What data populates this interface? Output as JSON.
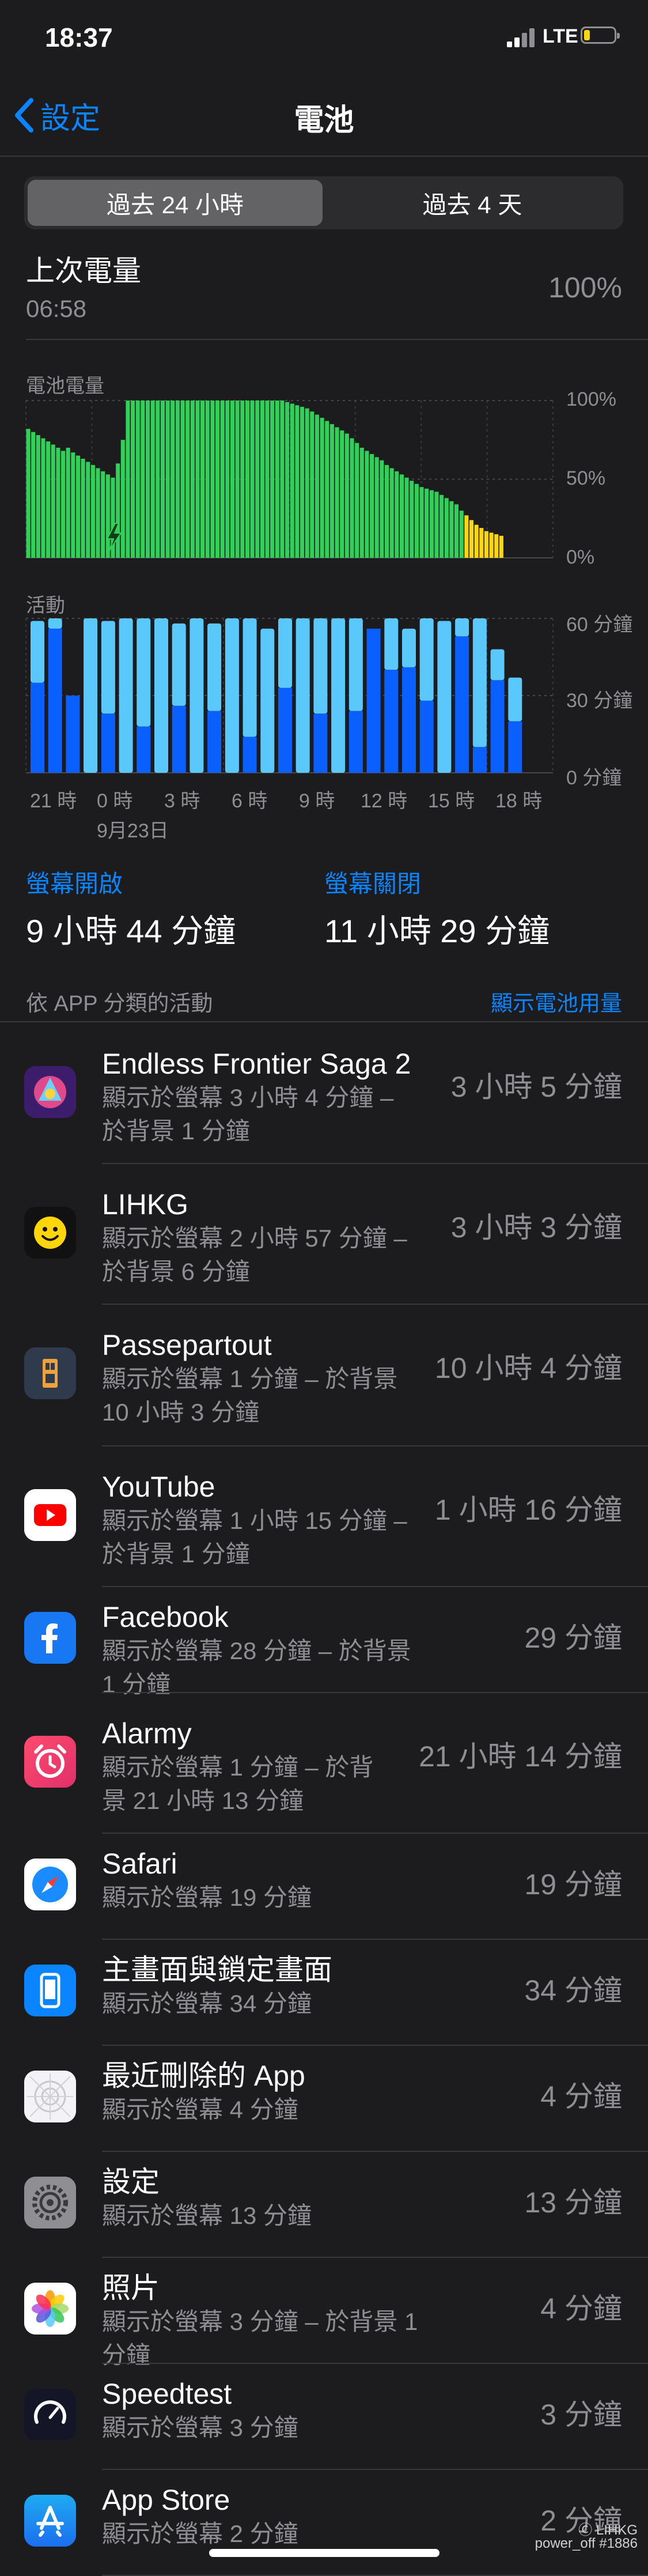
{
  "status_bar": {
    "time": "18:37",
    "network": "LTE"
  },
  "nav": {
    "back_label": "設定",
    "title": "電池"
  },
  "segments": [
    "過去 24 小時",
    "過去 4 天"
  ],
  "last_charge": {
    "title": "上次電量",
    "time": "06:58",
    "percent": "100%"
  },
  "battery_chart": {
    "label": "電池電量",
    "y_ticks": [
      "100%",
      "50%",
      "0%"
    ]
  },
  "activity_chart": {
    "label": "活動",
    "y_ticks": [
      "60 分鐘",
      "30 分鐘",
      "0 分鐘"
    ]
  },
  "x_axis": {
    "ticks": [
      "21 時",
      "0 時",
      "3 時",
      "6 時",
      "9 時",
      "12 時",
      "15 時",
      "18 時"
    ],
    "date": "9月23日"
  },
  "chart_data": [
    {
      "type": "bar",
      "title": "電池電量",
      "ylim": [
        0,
        100
      ],
      "values": [
        82,
        80,
        78,
        76,
        74,
        72,
        70,
        68,
        70,
        67,
        65,
        63,
        61,
        59,
        57,
        55,
        53,
        51,
        60,
        75,
        100,
        100,
        100,
        100,
        100,
        100,
        100,
        100,
        100,
        100,
        100,
        100,
        100,
        100,
        100,
        100,
        100,
        100,
        100,
        100,
        100,
        100,
        100,
        100,
        100,
        100,
        100,
        100,
        100,
        100,
        100,
        100,
        99,
        98,
        97,
        96,
        95,
        93,
        91,
        89,
        87,
        85,
        83,
        81,
        79,
        76,
        73,
        70,
        68,
        66,
        64,
        62,
        59,
        57,
        55,
        53,
        51,
        49,
        47,
        45,
        44,
        43,
        42,
        40,
        38,
        36,
        34,
        30,
        27,
        24,
        21,
        19,
        17,
        16,
        15,
        14
      ],
      "low_battery_from_index": 88,
      "charging_indices": [
        10,
        11,
        12,
        13,
        14,
        15,
        16,
        17,
        18,
        19,
        20
      ]
    },
    {
      "type": "bar",
      "title": "活動",
      "ylim": [
        0,
        60
      ],
      "series": [
        {
          "name": "螢幕開啟",
          "values": [
            35,
            56,
            30,
            0,
            23,
            0,
            18,
            0,
            26,
            0,
            24,
            0,
            14,
            0,
            33,
            0,
            23,
            0,
            24,
            56,
            40,
            41,
            28,
            0,
            53,
            10,
            36,
            20
          ]
        },
        {
          "name": "螢幕關閉",
          "values": [
            24,
            4,
            0,
            60,
            36,
            60,
            42,
            60,
            32,
            60,
            34,
            60,
            46,
            56,
            27,
            60,
            37,
            60,
            36,
            0,
            20,
            15,
            32,
            59,
            7,
            50,
            12,
            17
          ]
        }
      ]
    }
  ],
  "screen_on": {
    "label": "螢幕開啟",
    "value": "9 小時 44 分鐘"
  },
  "screen_off": {
    "label": "螢幕關閉",
    "value": "11 小時 29 分鐘"
  },
  "section": {
    "title": "依 APP 分類的活動",
    "link": "顯示電池用量"
  },
  "apps": [
    {
      "name": "Endless Frontier Saga 2",
      "detail": [
        "顯示於螢幕 3 小時 4 分鐘 –",
        "於背景 1 分鐘"
      ],
      "duration": "3 小時 5 分鐘",
      "icon": "game-icon",
      "color": "#5b2a86"
    },
    {
      "name": "LIHKG",
      "detail": [
        "顯示於螢幕 2 小時 57 分鐘 –",
        "於背景 6 分鐘"
      ],
      "duration": "3 小時 3 分鐘",
      "icon": "smiley-icon",
      "color": "#111111"
    },
    {
      "name": "Passepartout",
      "detail": [
        "顯示於螢幕 1 分鐘 – 於背景",
        "10 小時 3 分鐘"
      ],
      "duration": "10 小時 4 分鐘",
      "icon": "passepartout-icon",
      "color": "#2f3b4c"
    },
    {
      "name": "YouTube",
      "detail": [
        "顯示於螢幕 1 小時 15 分鐘 –",
        "於背景 1 分鐘"
      ],
      "duration": "1 小時 16 分鐘",
      "icon": "youtube-icon",
      "color": "#ffffff"
    },
    {
      "name": "Facebook",
      "detail": [
        "顯示於螢幕 28 分鐘 – 於背景 1 分鐘"
      ],
      "duration": "29 分鐘",
      "icon": "facebook-icon",
      "color": "#1877f2"
    },
    {
      "name": "Alarmy",
      "detail": [
        "顯示於螢幕 1 分鐘 – 於背",
        "景 21 小時 13 分鐘"
      ],
      "duration": "21 小時 14 分鐘",
      "icon": "alarm-clock-icon",
      "color": "#f0365a"
    },
    {
      "name": "Safari",
      "detail": [
        "顯示於螢幕 19 分鐘"
      ],
      "duration": "19 分鐘",
      "icon": "compass-icon",
      "color": "#ffffff"
    },
    {
      "name": "主畫面與鎖定畫面",
      "detail": [
        "顯示於螢幕 34 分鐘"
      ],
      "duration": "34 分鐘",
      "icon": "phone-icon",
      "color": "#0a84ff"
    },
    {
      "name": "最近刪除的 App",
      "detail": [
        "顯示於螢幕 4 分鐘"
      ],
      "duration": "4 分鐘",
      "icon": "app-placeholder-icon",
      "color": "#f2f2f7"
    },
    {
      "name": "設定",
      "detail": [
        "顯示於螢幕 13 分鐘"
      ],
      "duration": "13 分鐘",
      "icon": "gear-icon",
      "color": "#8e8e93"
    },
    {
      "name": "照片",
      "detail": [
        "顯示於螢幕 3 分鐘 – 於背景 1 分鐘"
      ],
      "duration": "4 分鐘",
      "icon": "photos-icon",
      "color": "#ffffff"
    },
    {
      "name": "Speedtest",
      "detail": [
        "顯示於螢幕 3 分鐘"
      ],
      "duration": "3 分鐘",
      "icon": "speedometer-icon",
      "color": "#141526"
    },
    {
      "name": "App Store",
      "detail": [
        "顯示於螢幕 2 分鐘"
      ],
      "duration": "2 分鐘",
      "icon": "app-store-icon",
      "color": "#0a84ff"
    }
  ],
  "watermark": {
    "line1": "Ⓒ LIHKG",
    "line2": "power_off #1886"
  },
  "colors": {
    "accent": "#0a84ff",
    "battery_green": "#30d158",
    "battery_low": "#ffd60a",
    "screen_on": "#0a60ff",
    "screen_off": "#5ac8fa"
  }
}
